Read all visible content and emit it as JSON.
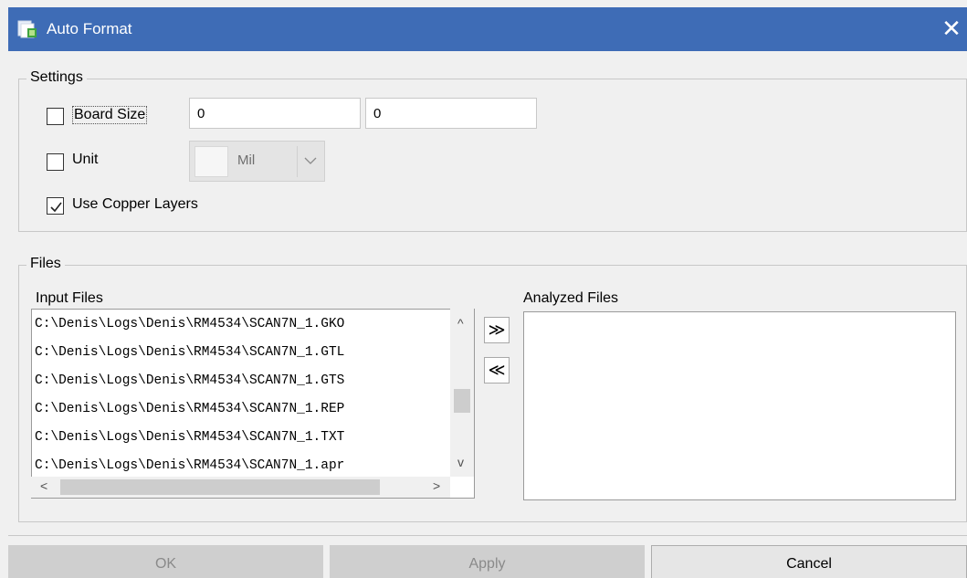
{
  "window": {
    "title": "Auto Format",
    "close_glyph": "✕",
    "title_color": "#3e6cb6"
  },
  "settings": {
    "legend": "Settings",
    "board_size": {
      "label": "Board Size",
      "checked": false,
      "width_value": "0",
      "height_value": "0"
    },
    "unit": {
      "label": "Unit",
      "checked": false,
      "selected": "Mil"
    },
    "use_copper_layers": {
      "label": "Use Copper Layers",
      "checked": true
    }
  },
  "files": {
    "legend": "Files",
    "input_label": "Input Files",
    "analyzed_label": "Analyzed Files",
    "input_files": [
      "C:\\Denis\\Logs\\Denis\\RM4534\\SCAN7N_1.GKO",
      "C:\\Denis\\Logs\\Denis\\RM4534\\SCAN7N_1.GTL",
      "C:\\Denis\\Logs\\Denis\\RM4534\\SCAN7N_1.GTS",
      "C:\\Denis\\Logs\\Denis\\RM4534\\SCAN7N_1.REP",
      "C:\\Denis\\Logs\\Denis\\RM4534\\SCAN7N_1.TXT",
      "C:\\Denis\\Logs\\Denis\\RM4534\\SCAN7N_1.apr"
    ],
    "add_glyph": "≫",
    "remove_glyph": "≪"
  },
  "buttons": {
    "ok": "OK",
    "apply": "Apply",
    "cancel": "Cancel"
  },
  "icons": {
    "title": "app-icon",
    "scroll_up": "^",
    "scroll_down": "v",
    "scroll_left": "<",
    "scroll_right": ">"
  }
}
